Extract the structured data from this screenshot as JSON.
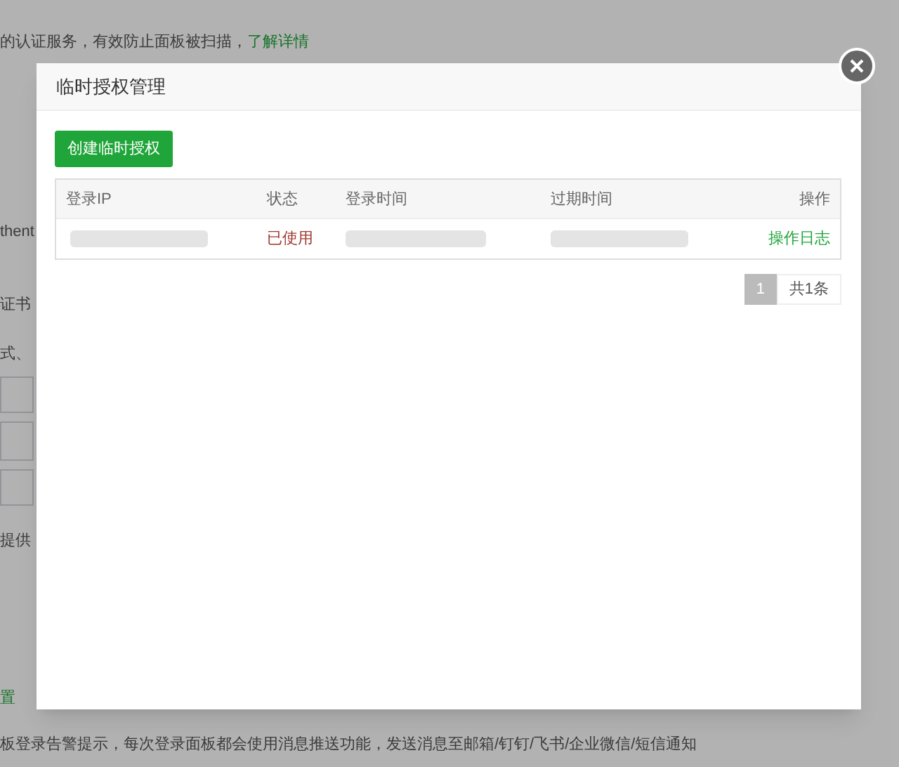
{
  "background": {
    "lines": [
      {
        "kind": "text",
        "text": "的认证服务，有效防止面板被扫描，",
        "link": "了解详情"
      },
      {
        "kind": "text",
        "text": "thent"
      },
      {
        "kind": "text",
        "text": "证书"
      },
      {
        "kind": "text",
        "text": "式、"
      },
      {
        "kind": "fields"
      },
      {
        "kind": "text",
        "text": "提供"
      },
      {
        "kind": "link",
        "text": "置"
      },
      {
        "kind": "text",
        "text": "板登录告警提示，每次登录面板都会使用消息推送功能，发送消息至邮箱/钉钉/飞书/企业微信/短信通知"
      }
    ]
  },
  "dialog": {
    "title": "临时授权管理",
    "create_button": "创建临时授权",
    "table": {
      "columns": [
        "登录IP",
        "状态",
        "登录时间",
        "过期时间",
        "操作"
      ],
      "rows": [
        {
          "status": "已使用",
          "action": "操作日志"
        }
      ]
    },
    "pagination": {
      "pages": [
        {
          "label": "1",
          "selected": true
        }
      ],
      "total": "共1条"
    }
  }
}
